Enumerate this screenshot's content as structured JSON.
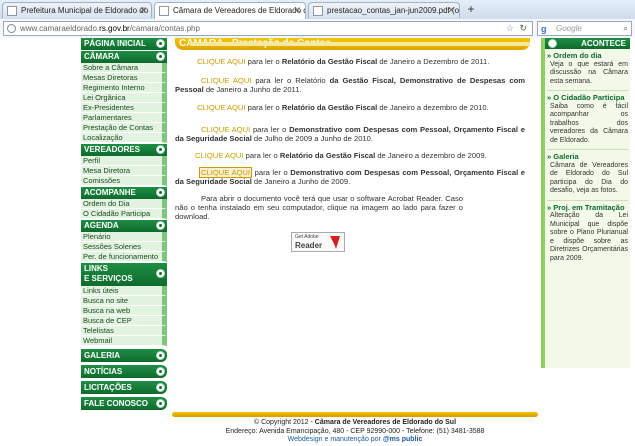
{
  "browser": {
    "tabs": [
      {
        "title": "Prefeitura Municipal de Eldorado do ...",
        "active": false
      },
      {
        "title": "Câmara de Vereadores de Eldorado d...",
        "active": true
      },
      {
        "title": "prestacao_contas_jan-jun2009.pdf (o...",
        "active": false
      }
    ],
    "new_tab": "+",
    "url_prefix": "www.camaraeldorado.",
    "url_host": "rs.gov.br",
    "url_path": "/camara/contas.php",
    "search_placeholder": "Google",
    "search_logo": "g"
  },
  "nav": {
    "home": "PÁGINA INICIAL",
    "camara": {
      "heading": "CÂMARA",
      "items": [
        "Sobre a Câmara",
        "Mesas Diretoras",
        "Regimento Interno",
        "Lei Orgânica",
        "Ex-Presidentes",
        "Parlamentares",
        "Prestação de Contas",
        "Localização"
      ]
    },
    "vereadores": {
      "heading": "VEREADORES",
      "items": [
        "Perfil",
        "Mesa Diretora",
        "Comissões"
      ]
    },
    "acompanhe": {
      "heading": "ACOMPANHE",
      "items": [
        "Ordem do Dia",
        "O Cidadão Participa"
      ]
    },
    "agenda": {
      "heading": "AGENDA",
      "items": [
        "Plenário",
        "Sessões Solenes",
        "Per. de funcionamento"
      ]
    },
    "links": {
      "heading_1": "LINKS",
      "heading_2": "E SERVIÇOS",
      "items": [
        "Links úteis",
        "Busca no site",
        "Busca na web",
        "Busca de CEP",
        "Telelistas",
        "Webmail"
      ]
    },
    "bottom": [
      "GALERIA",
      "NOTÍCIAS",
      "LICITAÇÕES",
      "FALE CONOSCO"
    ]
  },
  "banner": {
    "title": "CÂMARA - Prestação de Contas"
  },
  "content": {
    "click_here": "CLIQUE AQUI",
    "entries": [
      {
        "pre": " para ler o ",
        "bold": "Relatório da Gestão Fiscal",
        "post": " de Janeiro a Dezembro de 2011."
      },
      {
        "pre": " para ler o Relatório ",
        "bold": "da Gestão Fiscal, Demonstrativo de Despesas com Pessoal",
        "post": " de Janeiro a Junho de 2011."
      },
      {
        "pre": " para ler o ",
        "bold": "Relatório da Gestão Fiscal",
        "post": " de Janeiro a dezembro de 2010."
      },
      {
        "pre": " para ler o ",
        "bold": "Demonstrativo com Despesas com Pessoal, Orçamento Fiscal e da Seguridade Social",
        "post": " de Julho de 2009 a Junho de 2010."
      },
      {
        "pre": " para ler o ",
        "bold": "Relatório da Gestão Fiscal",
        "post": " de Janeiro a dezembro de 2009."
      },
      {
        "pre": " para ler o ",
        "bold": "Demonstrativo com Despesas com Pessoal, Orçamento Fiscal e da Seguridade Social",
        "post": " de Janeiro a Junho de 2009."
      }
    ],
    "acrobat_note": "Para abrir o documento você terá que usar o software Acrobat Reader. Caso não o tenha instalado em seu computador, clique na imagem ao lado para fazer o download.",
    "adobe_badge": {
      "line1": "Get Adobe",
      "line2": "Reader"
    }
  },
  "sidebar": {
    "heading": "ACONTECE",
    "blocks": [
      {
        "title": "» Ordem do dia",
        "text": "Veja o que estará em discussão na Câmara esta semana."
      },
      {
        "title": "» O Cidadão Participa",
        "text": "Saiba como é fácil acompanhar os trabalhos dos vereadores da Câmara de Eldorado."
      },
      {
        "title": "» Galeria",
        "text": "Câmara de Vereadores de Eldorado do Sul participa do Dia do desafio, veja as fotos."
      },
      {
        "title": "» Proj. em Tramitação",
        "text": "Alteração da Lei Municipal que dispõe sobre o Plano Plurianual e dispõe sobre as Diretrizes Orçamentárias para 2009."
      }
    ]
  },
  "footer": {
    "copyright": "© Copyright 2012 - ",
    "org": "Câmara de Vereadores de Eldorado do Sul",
    "address": "Endereço: Avenida Emancipação, 480 - CEP 92990-000 - Telefone: (51) 3481-3588",
    "credit_pre": "Webdesign e manutenção por ",
    "credit_name": "@ms public"
  }
}
